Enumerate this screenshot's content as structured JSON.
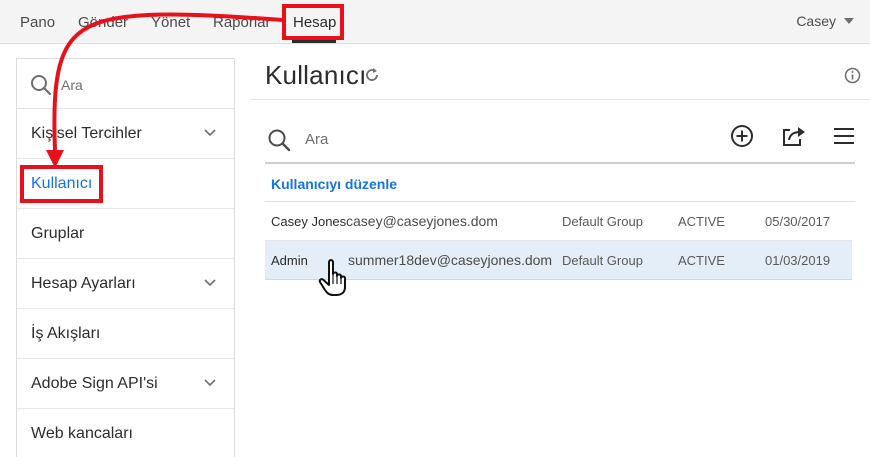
{
  "topnav": {
    "items": [
      "Pano",
      "Gönder",
      "Yönet",
      "Raporlar",
      "Hesap"
    ],
    "active": "Hesap",
    "user": "Casey"
  },
  "sidebar": {
    "search_placeholder": "Ara",
    "items": [
      {
        "label": "Kişisel Tercihler",
        "expandable": true
      },
      {
        "label": "Kullanıcı",
        "active": true
      },
      {
        "label": "Gruplar"
      },
      {
        "label": "Hesap Ayarları",
        "expandable": true
      },
      {
        "label": "İş Akışları"
      },
      {
        "label": "Adobe Sign API'si",
        "expandable": true
      },
      {
        "label": "Web kancaları"
      }
    ]
  },
  "main": {
    "title": "Kullanıcı",
    "search_placeholder": "Ara",
    "edit_link": "Kullanıcıyı düzenle",
    "rows": [
      {
        "name": "Casey Jones",
        "email": "casey@caseyjones.dom",
        "group": "Default Group",
        "status": "ACTIVE",
        "date": "05/30/2017"
      },
      {
        "name": "Admin",
        "email": "summer18dev@caseyjones.dom",
        "group": "Default Group",
        "status": "ACTIVE",
        "date": "01/03/2019",
        "selected": true
      }
    ]
  },
  "colors": {
    "annotation_red": "#e8101b",
    "link_blue": "#1473e6",
    "selected_row": "#e3eef8"
  },
  "icons": [
    "search-icon",
    "chevron-down-icon",
    "refresh-icon",
    "info-icon",
    "add-circle-icon",
    "share-icon",
    "hamburger-menu-icon",
    "pointer-hand-icon"
  ]
}
